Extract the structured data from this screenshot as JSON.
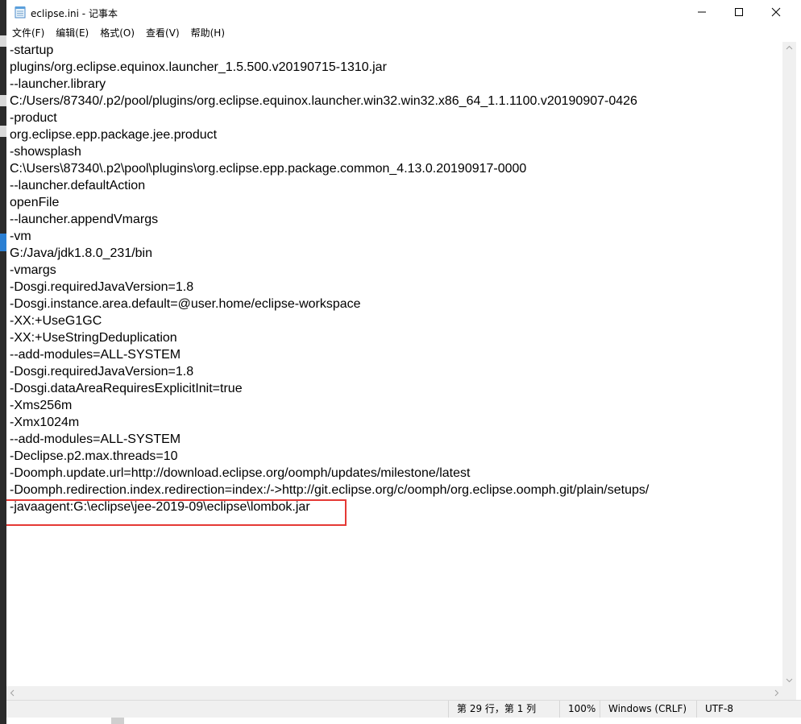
{
  "window": {
    "title": "eclipse.ini - 记事本",
    "icon": "notepad-icon",
    "controls": [
      "minimize-icon",
      "maximize-icon",
      "close-icon"
    ]
  },
  "menu": [
    {
      "label": "文件(F)"
    },
    {
      "label": "编辑(E)"
    },
    {
      "label": "格式(O)"
    },
    {
      "label": "查看(V)"
    },
    {
      "label": "帮助(H)"
    }
  ],
  "editor": {
    "lines": [
      "-startup",
      "plugins/org.eclipse.equinox.launcher_1.5.500.v20190715-1310.jar",
      "--launcher.library",
      "C:/Users/87340/.p2/pool/plugins/org.eclipse.equinox.launcher.win32.win32.x86_64_1.1.1100.v20190907-0426",
      "-product",
      "org.eclipse.epp.package.jee.product",
      "-showsplash",
      "C:\\Users\\87340\\.p2\\pool\\plugins\\org.eclipse.epp.package.common_4.13.0.20190917-0000",
      "--launcher.defaultAction",
      "openFile",
      "--launcher.appendVmargs",
      "-vm",
      "G:/Java/jdk1.8.0_231/bin",
      "-vmargs",
      "-Dosgi.requiredJavaVersion=1.8",
      "-Dosgi.instance.area.default=@user.home/eclipse-workspace",
      "-XX:+UseG1GC",
      "-XX:+UseStringDeduplication",
      "--add-modules=ALL-SYSTEM",
      "-Dosgi.requiredJavaVersion=1.8",
      "-Dosgi.dataAreaRequiresExplicitInit=true",
      "-Xms256m",
      "-Xmx1024m",
      "--add-modules=ALL-SYSTEM",
      "-Declipse.p2.max.threads=10",
      "-Doomph.update.url=http://download.eclipse.org/oomph/updates/milestone/latest",
      "-Doomph.redirection.index.redirection=index:/->http://git.eclipse.org/c/oomph/org.eclipse.oomph.git/plain/setups/",
      "-javaagent:G:\\eclipse\\jee-2019-09\\eclipse\\lombok.jar"
    ],
    "highlight_color": "#e53935"
  },
  "status": {
    "position": "第 29 行，第 1 列",
    "zoom": "100%",
    "line_ending": "Windows (CRLF)",
    "encoding": "UTF-8"
  }
}
